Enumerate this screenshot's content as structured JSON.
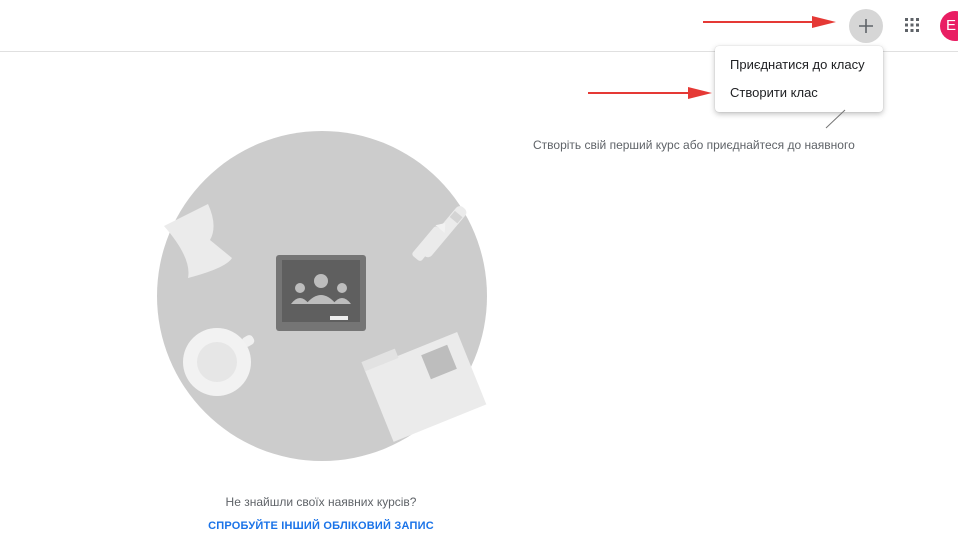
{
  "header": {
    "add_icon": "plus-icon",
    "apps_icon": "grid-icon",
    "avatar_letter": "E"
  },
  "menu": {
    "items": [
      {
        "label": "Приєднатися до класу"
      },
      {
        "label": "Створити клас"
      }
    ]
  },
  "empty_state": {
    "hint": "Створіть свій перший курс або приєднайтеся до наявного",
    "message": "Не знайшли своїх наявних курсів?",
    "link": "СПРОБУЙТЕ ІНШИЙ ОБЛІКОВИЙ ЗАПИС"
  },
  "colors": {
    "avatar": "#e91e63",
    "link": "#1a73e8",
    "annotation_arrow": "#e53935",
    "illustration_bg": "#cccccc"
  }
}
